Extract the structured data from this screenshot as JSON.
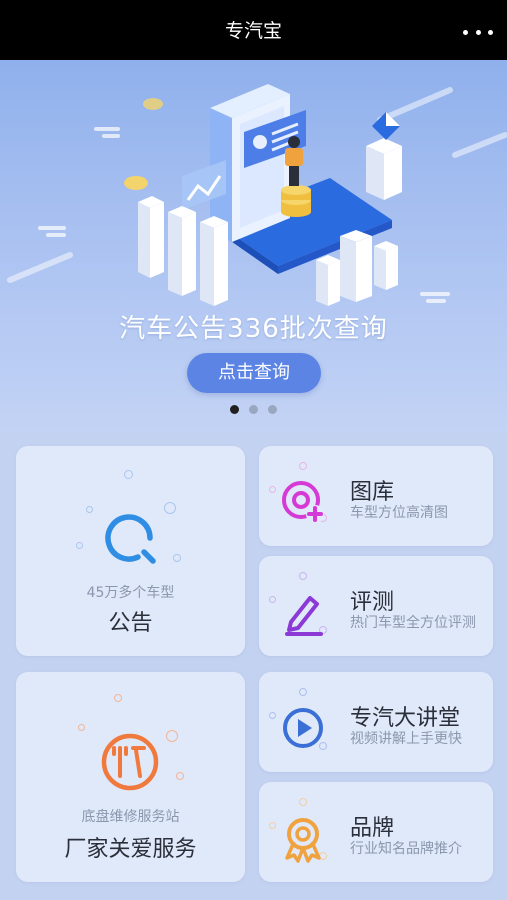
{
  "topbar": {
    "title": "专汽宝",
    "more_icon": "more-dots-icon"
  },
  "banner": {
    "headline": "汽车公告336批次查询",
    "cta_label": "点击查询",
    "slide_count": 3,
    "active_slide": 1
  },
  "cards": {
    "announcement": {
      "sub": "45万多个车型",
      "title": "公告",
      "icon": "search-icon",
      "color": "#2f8de4"
    },
    "gallery": {
      "title": "图库",
      "desc": "车型方位高清图",
      "icon": "add-image-icon",
      "color": "#d63ad6"
    },
    "review": {
      "title": "评测",
      "desc": "热门车型全方位评测",
      "icon": "edit-pen-icon",
      "color": "#8b3ad6"
    },
    "lecture": {
      "title": "专汽大讲堂",
      "desc": "视频讲解上手更快",
      "icon": "play-icon",
      "color": "#3a6fd6"
    },
    "service": {
      "sub": "底盘维修服务站",
      "title": "厂家关爱服务",
      "icon": "tools-icon",
      "color": "#f07a3e"
    },
    "brand": {
      "title": "品牌",
      "desc": "行业知名品牌推介",
      "icon": "award-ribbon-icon",
      "color": "#f0a23e"
    }
  }
}
